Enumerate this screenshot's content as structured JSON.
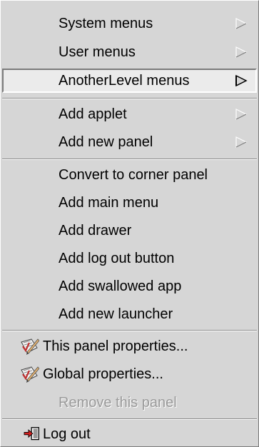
{
  "menu": {
    "groups": [
      [
        {
          "label": "System menus",
          "submenu": true
        },
        {
          "label": "User menus",
          "submenu": true
        },
        {
          "label": "AnotherLevel menus",
          "submenu": true,
          "active": true
        }
      ],
      [
        {
          "label": "Add applet",
          "submenu": true
        },
        {
          "label": "Add new panel",
          "submenu": true
        }
      ],
      [
        {
          "label": "Convert to corner panel"
        },
        {
          "label": "Add main menu"
        },
        {
          "label": "Add drawer"
        },
        {
          "label": "Add log out button"
        },
        {
          "label": "Add swallowed app"
        },
        {
          "label": "Add new launcher"
        }
      ],
      [
        {
          "label": "This panel properties...",
          "icon": "properties-icon"
        },
        {
          "label": "Global properties...",
          "icon": "properties-icon"
        },
        {
          "label": "Remove this panel",
          "disabled": true
        }
      ],
      [
        {
          "label": "Log out",
          "icon": "logout-icon"
        }
      ]
    ]
  }
}
